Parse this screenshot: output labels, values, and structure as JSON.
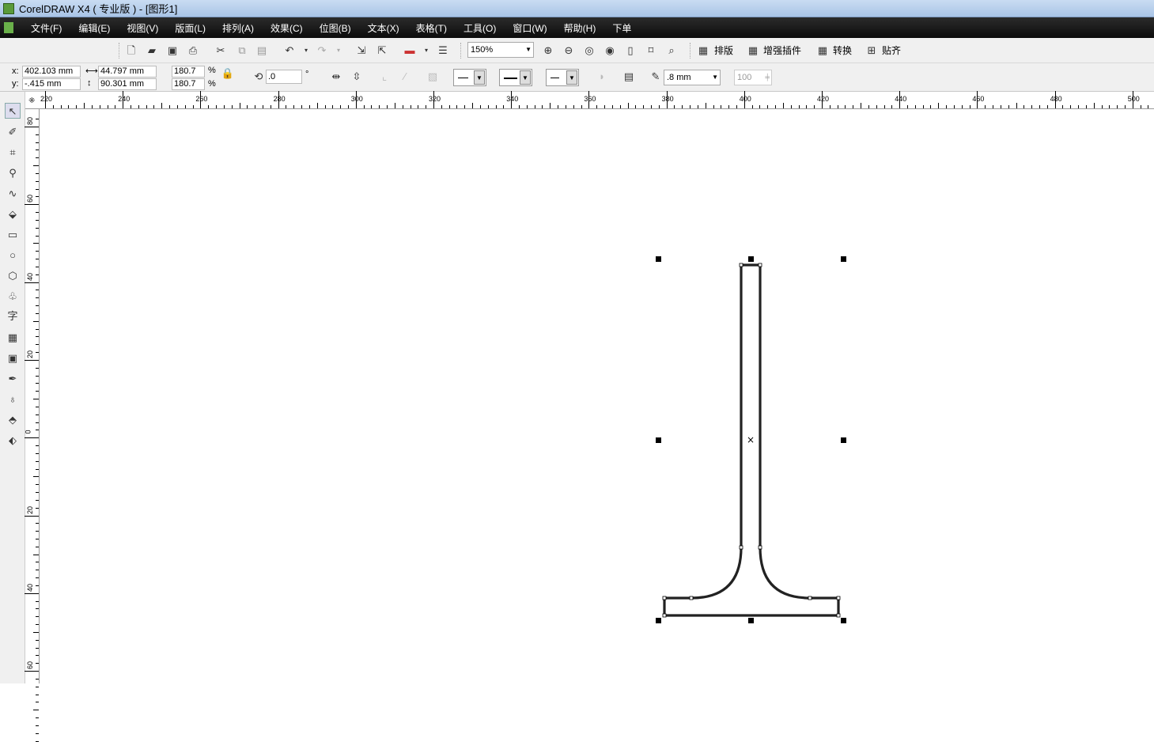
{
  "title": "CorelDRAW X4 ( 专业版 ) - [图形1]",
  "menu": [
    "文件(F)",
    "编辑(E)",
    "视图(V)",
    "版面(L)",
    "排列(A)",
    "效果(C)",
    "位图(B)",
    "文本(X)",
    "表格(T)",
    "工具(O)",
    "窗口(W)",
    "帮助(H)",
    "下单"
  ],
  "toolbar": {
    "zoom": "150%",
    "plugins": [
      "排版",
      "增强插件",
      "转换",
      "贴齐"
    ]
  },
  "props": {
    "x_label": "x:",
    "y_label": "y:",
    "x": "402.103 mm",
    "y": "-.415 mm",
    "width": "44.797 mm",
    "height": "90.301 mm",
    "scale_x": "180.7",
    "scale_y": "180.7",
    "pct": "%",
    "rotation": ".0",
    "deg": "°",
    "outline_width": ".8 mm",
    "opacity": "100"
  },
  "ruler": {
    "h": [
      "220",
      "240",
      "260",
      "280",
      "300",
      "320",
      "340",
      "360",
      "380",
      "400",
      "420",
      "440",
      "460",
      "480",
      "500"
    ],
    "v": [
      "80",
      "60",
      "40",
      "20",
      "0",
      "20",
      "40",
      "60"
    ]
  }
}
